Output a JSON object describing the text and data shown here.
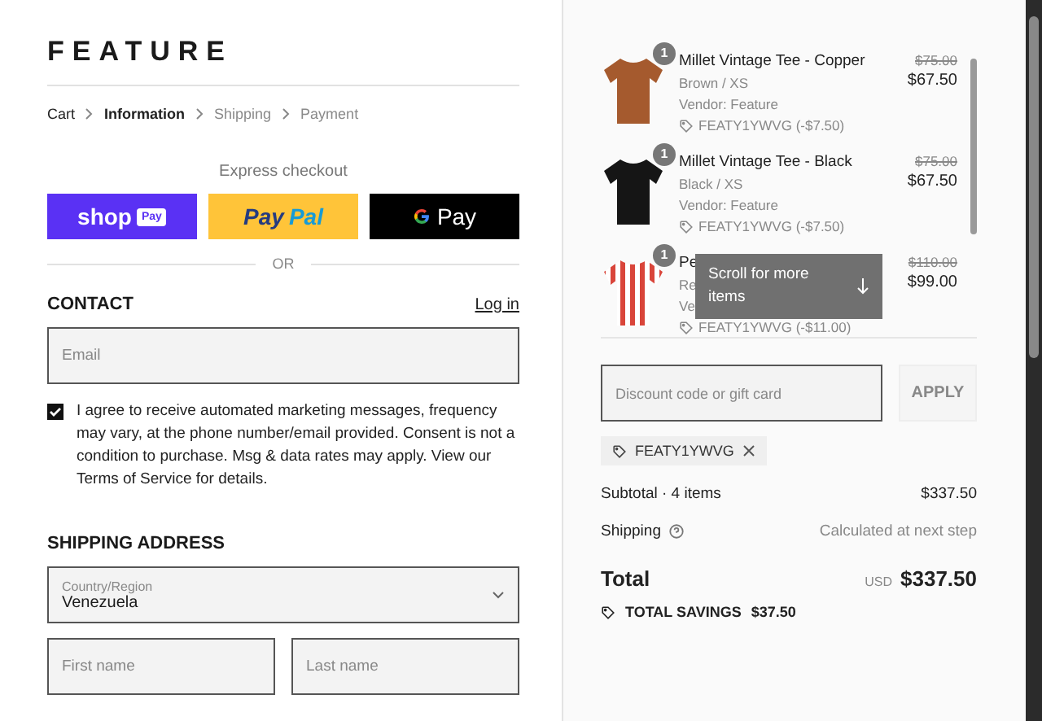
{
  "logo": "FEATURE",
  "breadcrumbs": [
    {
      "label": "Cart",
      "selected": false,
      "upcoming": false
    },
    {
      "label": "Information",
      "selected": true,
      "upcoming": false
    },
    {
      "label": "Shipping",
      "selected": false,
      "upcoming": true
    },
    {
      "label": "Payment",
      "selected": false,
      "upcoming": true
    }
  ],
  "express_checkout": {
    "title": "Express checkout",
    "buttons": [
      {
        "kind": "shop",
        "text": "shop",
        "badge": "Pay"
      },
      {
        "kind": "paypal",
        "text": "Pay",
        "text2": "Pal"
      },
      {
        "kind": "gpay",
        "text": "Pay"
      }
    ],
    "divider": "OR"
  },
  "contact": {
    "heading": "CONTACT",
    "login": "Log in",
    "email": {
      "placeholder": "Email"
    },
    "marketing_opt_in": {
      "checked": true,
      "text": "I agree to receive automated marketing messages, frequency may vary, at the phone number/email provided. Consent is not a condition to purchase. Msg & data rates may apply. View our Terms of Service for details."
    }
  },
  "shipping_address": {
    "heading": "SHIPPING ADDRESS",
    "country": {
      "label": "Country/Region",
      "value": "Venezuela"
    },
    "first_name": {
      "placeholder": "First name"
    },
    "last_name": {
      "placeholder": "Last name"
    }
  },
  "order_items": [
    {
      "quantity": "1",
      "title": "Millet Vintage Tee - Copper",
      "variant": "Brown / XS",
      "vendor": "Vendor: Feature",
      "discount": "FEATY1YWVG (-$7.50)",
      "original_price": "$75.00",
      "price": "$67.50",
      "color": "#a55a2e",
      "striped": false
    },
    {
      "quantity": "1",
      "title": "Millet Vintage Tee - Black",
      "variant": "Black / XS",
      "vendor": "Vendor: Feature",
      "discount": "FEATY1YWVG (-$7.50)",
      "original_price": "$75.00",
      "price": "$67.50",
      "color": "#151515",
      "striped": false
    },
    {
      "quantity": "1",
      "title": "Pe",
      "variant": "Re",
      "vendor": "Ve",
      "discount": "FEATY1YWVG (-$11.00)",
      "original_price": "$110.00",
      "price": "$99.00",
      "color": "#d9453a",
      "striped": true
    }
  ],
  "scroll_hint": "Scroll for more items",
  "discount": {
    "placeholder": "Discount code or gift card",
    "button": "APPLY",
    "applied_code": "FEATY1YWVG"
  },
  "summary": {
    "subtotal_label": "Subtotal · 4 items",
    "subtotal": "$337.50",
    "shipping_label": "Shipping",
    "shipping_value": "Calculated at next step",
    "total_label": "Total",
    "currency": "USD",
    "total": "$337.50",
    "savings_label": "TOTAL SAVINGS",
    "savings": "$37.50"
  }
}
